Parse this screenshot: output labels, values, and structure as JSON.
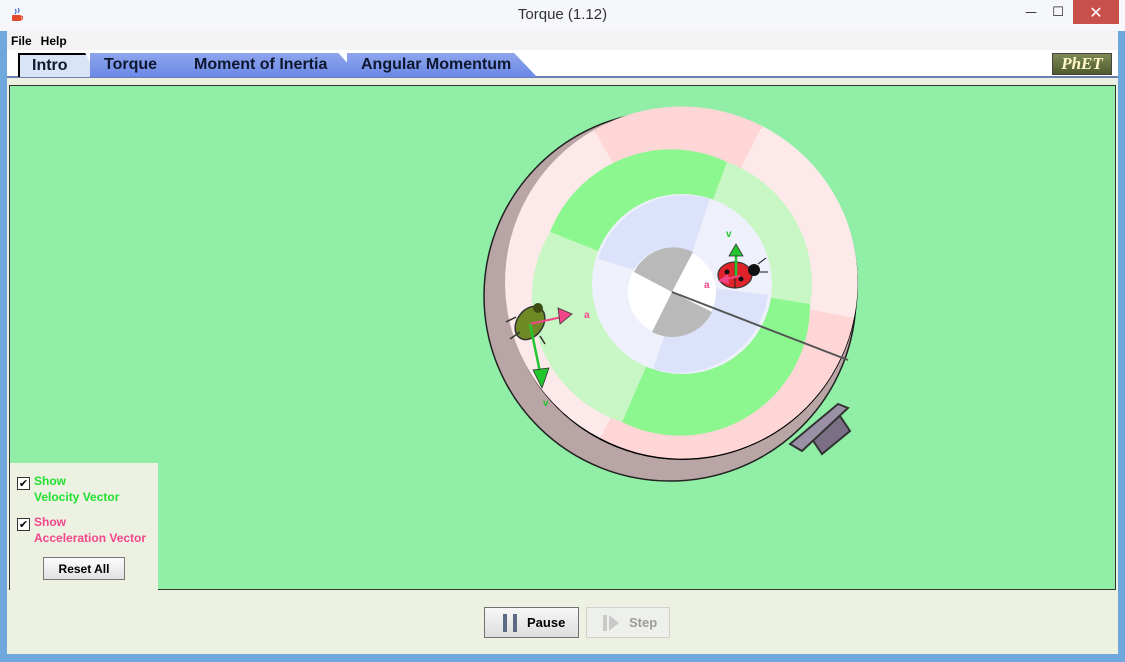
{
  "window": {
    "title": "Torque (1.12)",
    "close_glyph": "✕",
    "minimize_glyph": "—",
    "maximize_glyph": "☐"
  },
  "menu": [
    "File",
    "Help"
  ],
  "tabs": [
    {
      "label": "Intro",
      "active": true
    },
    {
      "label": "Torque",
      "active": false
    },
    {
      "label": "Moment of Inertia",
      "active": false
    },
    {
      "label": "Angular Momentum",
      "active": false
    }
  ],
  "logo_text": "PhET",
  "scene": {
    "velocity_label": "v",
    "acceleration_label": "a",
    "velocity_color": "#22c52e",
    "acceleration_color": "#f2458a",
    "background_color": "#90eea6"
  },
  "controls": {
    "show_velocity": {
      "line1": "Show",
      "line2": "Velocity Vector",
      "checked": true
    },
    "show_acceleration": {
      "line1": "Show",
      "line2": "Acceleration Vector",
      "checked": true
    },
    "reset_label": "Reset All"
  },
  "playback": {
    "pause_label": "Pause",
    "step_label": "Step",
    "step_enabled": false
  },
  "icons": {
    "app": "java-cup-icon",
    "check": "✔"
  }
}
